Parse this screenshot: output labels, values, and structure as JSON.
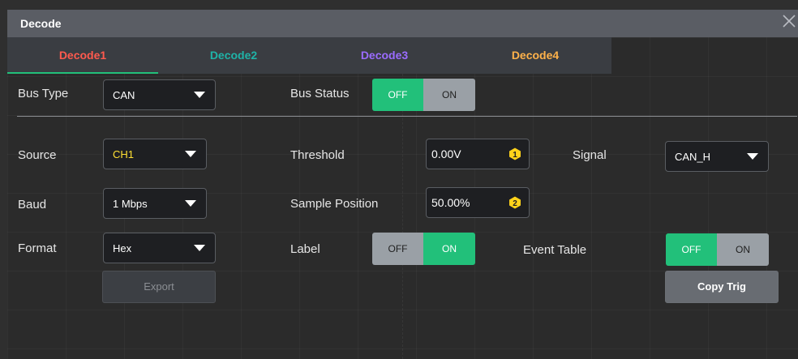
{
  "window": {
    "title": "Decode",
    "close_icon": "close-icon"
  },
  "tabs": [
    {
      "label": "Decode1",
      "color": "#ff5a4e",
      "active": true
    },
    {
      "label": "Decode2",
      "color": "#1fb3a8",
      "active": false
    },
    {
      "label": "Decode3",
      "color": "#9b6cff",
      "active": false
    },
    {
      "label": "Decode4",
      "color": "#ffb24a",
      "active": false
    }
  ],
  "bus_type": {
    "label": "Bus Type",
    "value": "CAN"
  },
  "bus_status": {
    "label": "Bus Status",
    "off": "OFF",
    "on": "ON",
    "selected": "OFF"
  },
  "source": {
    "label": "Source",
    "value": "CH1",
    "value_color": "#ffe033"
  },
  "threshold": {
    "label": "Threshold",
    "value": "0.00V",
    "badge": "1"
  },
  "signal": {
    "label": "Signal",
    "value": "CAN_H"
  },
  "baud": {
    "label": "Baud",
    "value": "1 Mbps"
  },
  "sample_position": {
    "label": "Sample Position",
    "value": "50.00%",
    "badge": "2"
  },
  "format": {
    "label": "Format",
    "value": "Hex"
  },
  "label_toggle": {
    "label": "Label",
    "off": "OFF",
    "on": "ON",
    "selected": "ON"
  },
  "event_table": {
    "label": "Event Table",
    "off": "OFF",
    "on": "ON",
    "selected": "OFF"
  },
  "export_button": {
    "label": "Export"
  },
  "copy_trig_button": {
    "label": "Copy Trig"
  },
  "colors": {
    "accent_green": "#22c07a",
    "badge_yellow": "#ffd21a",
    "panel_bg": "#2b2b2b"
  }
}
